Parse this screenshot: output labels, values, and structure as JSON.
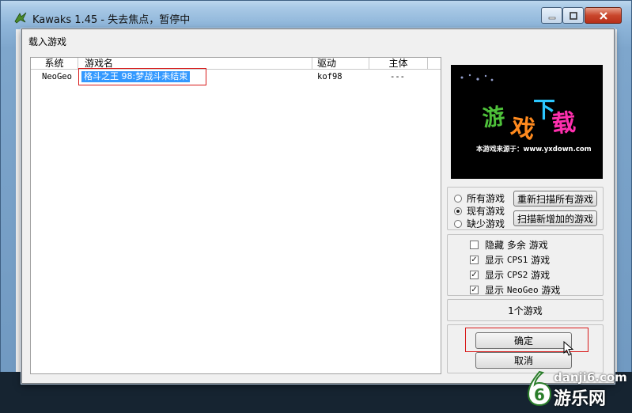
{
  "window": {
    "title": "Kawaks 1.45 - 失去焦点，暂停中"
  },
  "dialog": {
    "title": "载入游戏"
  },
  "list": {
    "columns": [
      "系统",
      "游戏名",
      "驱动",
      "主体"
    ],
    "rows": [
      {
        "system": "NeoGeo",
        "name": "格斗之王 98:梦战斗未结束",
        "driver": "kof98",
        "parent": "---"
      }
    ]
  },
  "preview": {
    "caption": "本游戏来源于：www.yxdown.com",
    "logo_chars": [
      "游",
      "戏",
      "下",
      "载"
    ]
  },
  "filter": {
    "options": [
      "所有游戏",
      "现有游戏",
      "缺少游戏"
    ],
    "selected": "现有游戏",
    "rescan_all": "重新扫描所有游戏",
    "scan_new": "扫描新增加的游戏"
  },
  "display": {
    "items": [
      {
        "prefix": "隐藏",
        "sys": "多余",
        "suffix": "游戏",
        "checked": false
      },
      {
        "prefix": "显示",
        "sys": "CPS1",
        "suffix": "游戏",
        "checked": true
      },
      {
        "prefix": "显示",
        "sys": "CPS2",
        "suffix": "游戏",
        "checked": true
      },
      {
        "prefix": "显示",
        "sys": "NeoGeo",
        "suffix": "游戏",
        "checked": true
      }
    ]
  },
  "count": "1个游戏",
  "buttons": {
    "ok": "确定",
    "cancel": "取消"
  },
  "watermark": {
    "digit": "6",
    "site": "danji6.com",
    "brand": "游乐网"
  },
  "colors": {
    "selection": "#3399ff",
    "highlight_box": "#d81a1a"
  }
}
